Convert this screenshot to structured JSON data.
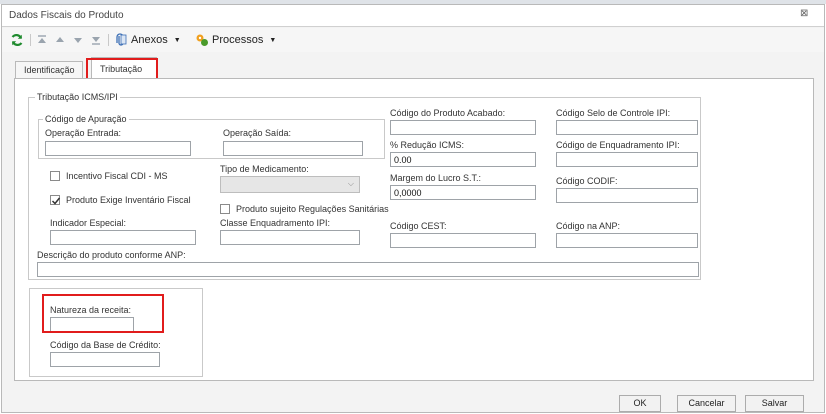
{
  "window": {
    "title": "Dados Fiscais do Produto",
    "maximize_glyph": "⊠"
  },
  "toolbar": {
    "refresh_icon": "refresh-icon",
    "anexos_label": "Anexos",
    "processos_label": "Processos"
  },
  "tabs": [
    {
      "label": "Identificação"
    },
    {
      "label": "Tributação"
    }
  ],
  "icms": {
    "group_title": "Tributação ICMS/IPI",
    "apuracao": {
      "title": "Código de Apuração",
      "operacao_entrada_label": "Operação Entrada:",
      "operacao_entrada_value": "",
      "operacao_saida_label": "Operação Saída:",
      "operacao_saida_value": ""
    },
    "incentivo_label": "Incentivo Fiscal  CDI - MS",
    "incentivo_checked": false,
    "exige_inventario_label": "Produto Exige Inventário Fiscal",
    "exige_inventario_checked": true,
    "tipo_medicamento_label": "Tipo de Medicamento:",
    "tipo_medicamento_value": "",
    "regulacoes_label": "Produto sujeito Regulações Sanitárias",
    "regulacoes_checked": false,
    "indicador_label": "Indicador Especial:",
    "indicador_value": "",
    "classe_label": "Classe Enquadramento IPI:",
    "classe_value": "",
    "produto_acabado_label": "Código do Produto Acabado:",
    "produto_acabado_value": "",
    "reducao_label": "% Redução ICMS:",
    "reducao_value": "0.00",
    "margem_label": "Margem do Lucro S.T.:",
    "margem_value": "0,0000",
    "cest_label": "Código CEST:",
    "cest_value": "",
    "selo_label": "Código Selo de Controle IPI:",
    "selo_value": "",
    "enquadramento_label": "Código de Enquadramento IPI:",
    "enquadramento_value": "",
    "codif_label": "Código CODIF:",
    "codif_value": "",
    "anp_label": "Código na ANP:",
    "anp_value": "",
    "descricao_anp_label": "Descrição do produto conforme ANP:",
    "descricao_anp_value": ""
  },
  "receita": {
    "natureza_label": "Natureza da receita:",
    "natureza_value": "",
    "base_credito_label": "Código da Base de Crédito:",
    "base_credito_value": ""
  },
  "footer": {
    "ok_label": "OK",
    "cancel_label": "Cancelar",
    "save_label": "Salvar"
  },
  "colors": {
    "highlight": "#e11c1c",
    "border": "#b9b9b9",
    "field_border": "#9ea3a8"
  }
}
